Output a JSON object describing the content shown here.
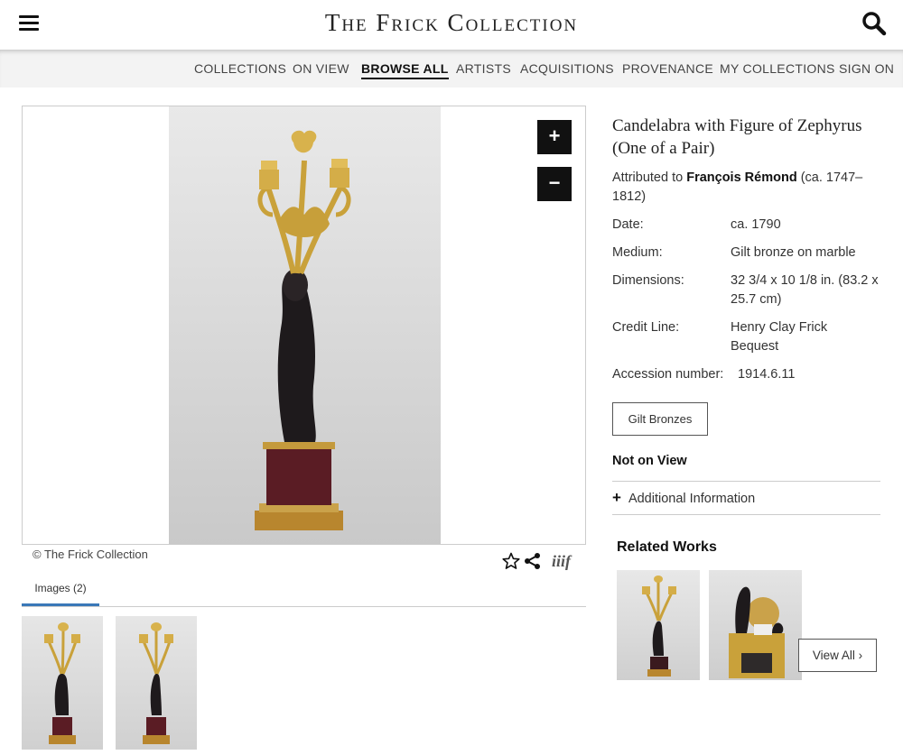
{
  "header": {
    "site_title": "The Frick Collection",
    "menu_icon": "hamburger-menu-icon",
    "search_icon": "search-icon"
  },
  "nav": {
    "items": [
      "COLLECTIONS",
      "ON VIEW",
      "BROWSE ALL",
      "ARTISTS",
      "ACQUISITIONS",
      "PROVENANCE",
      "MY COLLECTIONS",
      "SIGN ON"
    ],
    "active": "BROWSE ALL"
  },
  "viewer": {
    "zoom_in_label": "+",
    "zoom_out_label": "−",
    "copyright": "© The Frick Collection",
    "tools": [
      "star-icon",
      "share-icon",
      "iiif-icon"
    ],
    "iiif_label": "iiif"
  },
  "images_tab": {
    "label": "Images (2)",
    "accent": "#3a78b8"
  },
  "object": {
    "title": "Candelabra with Figure of Zephyrus (One of a Pair)",
    "attribution_prefix": "Attributed to",
    "artist": "François Rémond",
    "artist_dates": "(ca. 1747–1812)",
    "fields": [
      {
        "label": "Date:",
        "value": "ca. 1790"
      },
      {
        "label": "Medium:",
        "value": "Gilt bronze on marble"
      },
      {
        "label": "Dimensions:",
        "value": "32 3/4 x 10 1/8 in. (83.2 x 25.7 cm)"
      },
      {
        "label": "Credit Line:",
        "value": "Henry Clay Frick Bequest"
      },
      {
        "label": "Accession number:",
        "value": "1914.6.11"
      }
    ],
    "tag": "Gilt Bronzes",
    "status": "Not on View",
    "additional_info": "Additional Information"
  },
  "related": {
    "title": "Related Works",
    "view_all": "View All ›"
  }
}
